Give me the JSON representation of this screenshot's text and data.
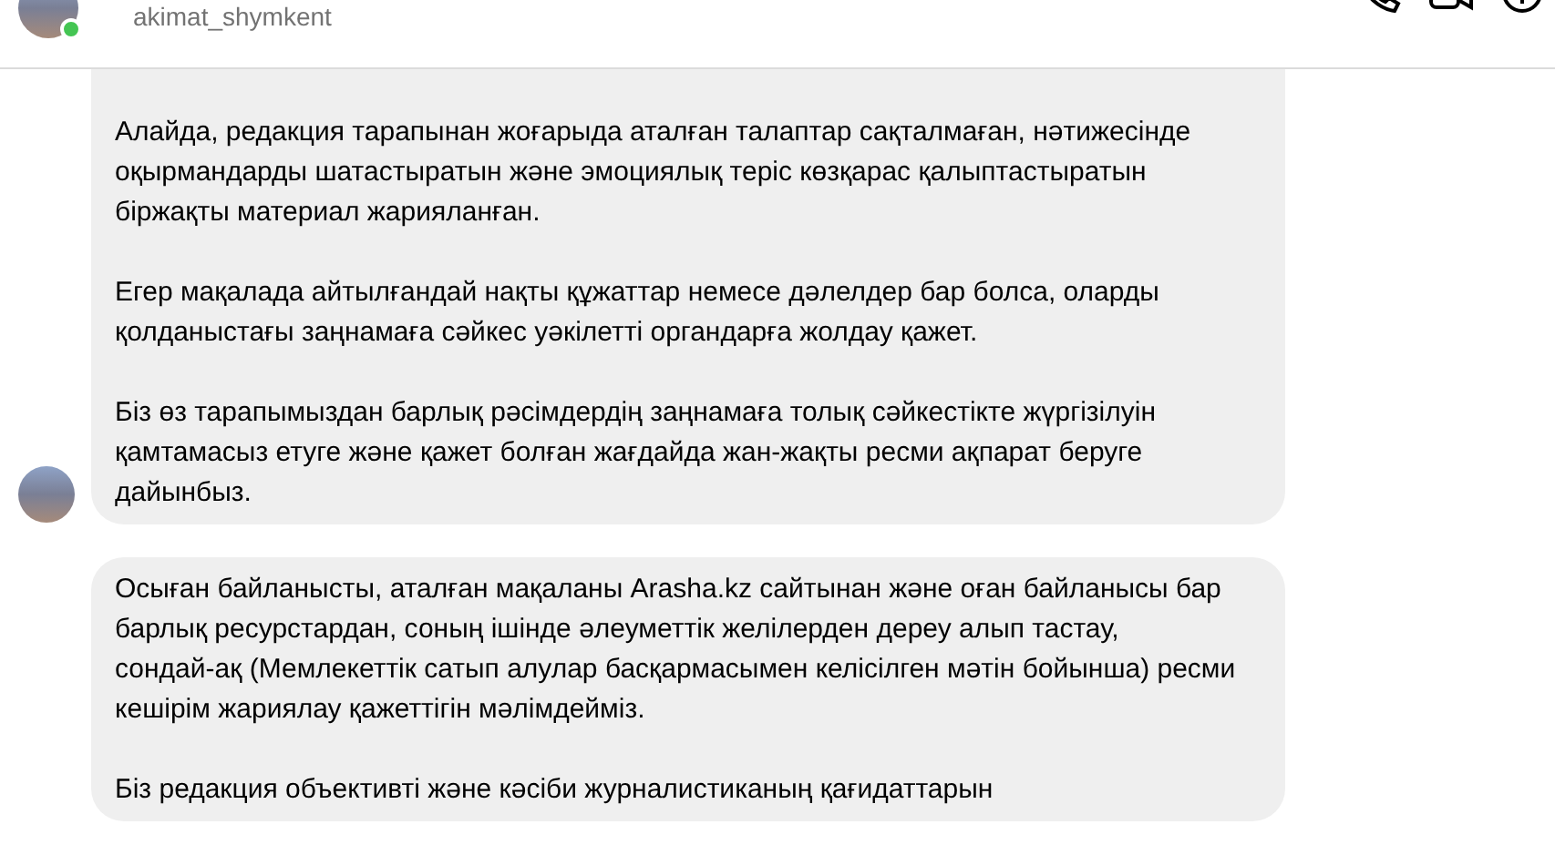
{
  "header": {
    "username": "akimat_shymkent",
    "online": true
  },
  "messages": [
    {
      "paragraphs": [
        "Алайда, редакция тарапынан жоғарыда аталған талаптар сақталмаған, нәтижесінде оқырмандарды шатастыратын және эмоциялық теріс көзқарас қалыптастыратын біржақты материал жарияланған.",
        "Егер мақалада айтылғандай нақты құжаттар немесе дәлелдер бар болса, оларды қолданыстағы заңнамаға сәйкес уәкілетті органдарға жолдау қажет.",
        "Біз өз тарапымыздан барлық рәсімдердің заңнамаға толық сәйкестікте жүргізілуін қамтамасыз етуге және қажет болған жағдайда жан-жақты ресми ақпарат беруге дайынбыз."
      ],
      "show_avatar": true
    },
    {
      "paragraphs": [
        "Осыған байланысты, аталған мақаланы Arasha.kz сайтынан және оған байланысы бар барлық ресурстардан, соның ішінде әлеуметтік желілерден дереу алып тастау,\nсондай-ақ (Мемлекеттік сатып алулар басқармасымен келісілген мәтін бойынша) ресми кешірім жариялау қажеттігін мәлімдейміз.",
        "Біз редакция объективті және кәсіби журналистиканың қағидаттарын"
      ],
      "show_avatar": false
    }
  ]
}
